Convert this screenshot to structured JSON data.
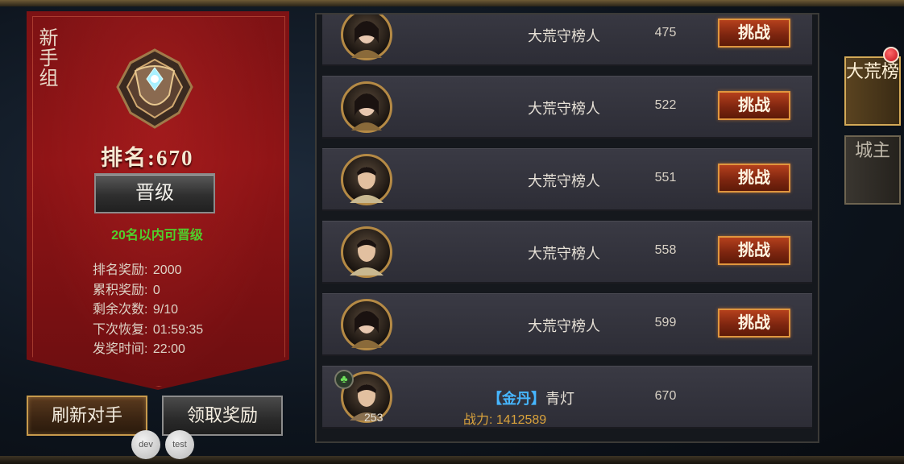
{
  "left_panel": {
    "group_title": "新手组",
    "rank_label": "排名:",
    "rank_value": "670",
    "promote_button": "晋级",
    "promote_note": "20名以内可晋级",
    "info": [
      {
        "label": "排名奖励:",
        "value": "2000"
      },
      {
        "label": "累积奖励:",
        "value": "0"
      },
      {
        "label": "剩余次数:",
        "value": "9/10"
      },
      {
        "label": "下次恢复:",
        "value": "01:59:35"
      },
      {
        "label": "发奖时间:",
        "value": "22:00"
      }
    ],
    "refresh_button": "刷新对手",
    "claim_button": "领取奖励"
  },
  "debug": {
    "dev_label": "dev",
    "test_label": "test"
  },
  "opponents": [
    {
      "name": "大荒守榜人",
      "rank": "475",
      "action": "挑战",
      "avatar": "female-warrior"
    },
    {
      "name": "大荒守榜人",
      "rank": "522",
      "action": "挑战",
      "avatar": "female-warrior"
    },
    {
      "name": "大荒守榜人",
      "rank": "551",
      "action": "挑战",
      "avatar": "male-warrior"
    },
    {
      "name": "大荒守榜人",
      "rank": "558",
      "action": "挑战",
      "avatar": "male-warrior"
    },
    {
      "name": "大荒守榜人",
      "rank": "599",
      "action": "挑战",
      "avatar": "female-warrior"
    }
  ],
  "self": {
    "tag": "【金丹】",
    "name": "青灯",
    "rank": "670",
    "power_label": "战力:",
    "power_value": "1412589",
    "level": "253",
    "badge_icon": "club-icon"
  },
  "side_tabs": [
    {
      "label": "大荒榜",
      "active": true
    },
    {
      "label": "城主",
      "active": false
    }
  ],
  "colors": {
    "banner_red": "#8f1416",
    "promote_note_green": "#4fd12c",
    "power_gold": "#d9a23c",
    "realm_tag_blue": "#46b6ff",
    "challenge_orange": "#b5401c"
  }
}
